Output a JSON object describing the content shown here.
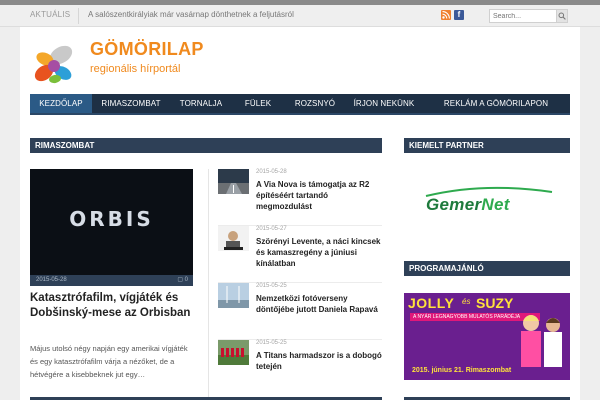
{
  "topbar": {
    "ticker_label": "AKTUÁLIS",
    "ticker_text": "A salószentkirályiak már vasárnap dönthetnek a feljutásról",
    "search_placeholder": "Search..."
  },
  "brand": {
    "title": "GÖMÖRILAP",
    "subtitle": "regionális hírportál",
    "accent": "#f08a1e"
  },
  "nav": {
    "items": [
      {
        "label": "KEZDŐLAP",
        "active": true
      },
      {
        "label": "RIMASZOMBAT"
      },
      {
        "label": "TORNALJA"
      },
      {
        "label": "FÜLEK"
      },
      {
        "label": "ROZSNYÓ"
      },
      {
        "label": "ÍRJON NEKÜNK"
      },
      {
        "label": "REKLÁM A GÖMÖRILAPON"
      }
    ],
    "bg": "#1e3045",
    "active_bg": "#2b5a86"
  },
  "section": {
    "title": "RIMASZOMBAT"
  },
  "feature": {
    "image_text": "ORBIS",
    "date": "2015-05-28",
    "comments": "0",
    "title": "Katasztrófafilm, vígjáték és Dobšinský-mese az Orbisban",
    "excerpt": "Május utolsó négy napján egy amerikai vígjáték és egy katasztrófafilm várja a nézőket, de a hétvégére a kisebbeknek jut egy…"
  },
  "list": [
    {
      "date": "2015-05-28",
      "title": "A Via Nova is támogatja az R2 építéséért tartandó megmozdulást",
      "thumb": "road-photo"
    },
    {
      "date": "2015-05-27",
      "title": "Szörényi Levente, a náci kincsek és kamaszregény a júniusi kínálatban",
      "thumb": "book-cover"
    },
    {
      "date": "2015-05-25",
      "title": "Nemzetközi fotóverseny döntőjébe jutott Daniela Rapavá",
      "thumb": "sky-photo"
    },
    {
      "date": "2015-05-25",
      "title": "A Titans harmadszor is a dobogó tetején",
      "thumb": "team-photo"
    }
  ],
  "sidebar": {
    "partner_title": "KIEMELT PARTNER",
    "partner_logo_a": "Gemer",
    "partner_logo_b": "Net",
    "program_title": "PROGRAMAJÁNLÓ",
    "program_title_a": "JOLLY",
    "program_title_es": "és",
    "program_title_b": "SUZY",
    "program_sub": "A NYÁR LEGNAGYOBB MULATÓS PARÁDÉJA",
    "program_date": "2015. június 21. Rimaszombat"
  }
}
